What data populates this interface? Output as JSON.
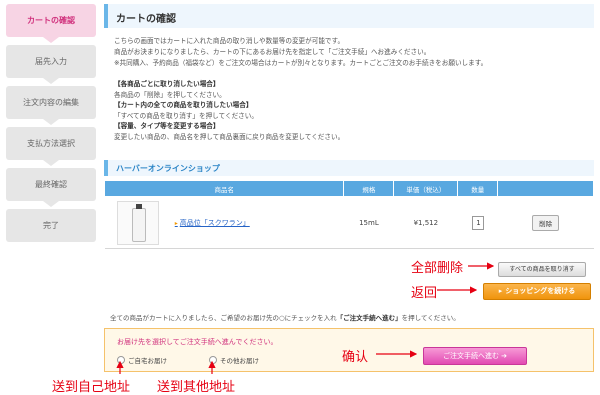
{
  "steps": [
    "カートの確認",
    "届先入力",
    "注文内容の編集",
    "支払方法選択",
    "最終確認",
    "完了"
  ],
  "page_title": "カートの確認",
  "intro": [
    "こちらの画面ではカートに入れた商品の取り消しや数量等の変更が可能です。",
    "商品がお決まりになりましたら、カートの下にあるお届け先を指定して「ご注文手続」へお進みください。",
    "※共同購入、予約商品（福袋など）をご注文の場合はカートが別々となります。カートごとご注文のお手続きをお願いします。"
  ],
  "notes": {
    "h1": "【各商品ごとに取り消したい場合】",
    "t1": "各商品の「削除」を押してください。",
    "h2": "【カート内の全ての商品を取り消したい場合】",
    "t2": "「すべての商品を取り消す」を押してください。",
    "h3": "【容量、タイプ等を変更する場合】",
    "t3": "変更したい商品の、商品名を押して商品裏面に戻り商品を変更してください。"
  },
  "shop_name": "ハーバーオンラインショップ",
  "table": {
    "headers": [
      "商品名",
      "規格",
      "単価（税込）",
      "数量",
      ""
    ],
    "row": {
      "name_prefix": "▸",
      "name": "高品位「スクワラン」",
      "spec": "15mL",
      "price": "¥1,512",
      "qty": "1",
      "delete": "削除"
    }
  },
  "buttons": {
    "remove_all": "すべての商品を取り消す",
    "continue": "ショッピングを続ける",
    "checkout": "ご注文手続へ進む ➔"
  },
  "lead_pre": "全ての商品がカートに入りましたら、ご希望のお届け先の○にチェックを入れ",
  "lead_bold": "「ご注文手続へ進む」",
  "lead_post": "を押してください。",
  "address": {
    "title": "お届け先を選択してご注文手続へ進んでください。",
    "option_self": "ご自宅お届け",
    "option_other": "その他お届け"
  },
  "annotations": {
    "remove_all": "全部删除",
    "back": "返回",
    "confirm": "确认",
    "self": "送到自己地址",
    "other": "送到其他地址"
  },
  "colors": {
    "accent_blue": "#59a8e0",
    "accent_pink": "#d0307c",
    "annotation_red": "#e60012",
    "orange": "#f0940d"
  }
}
